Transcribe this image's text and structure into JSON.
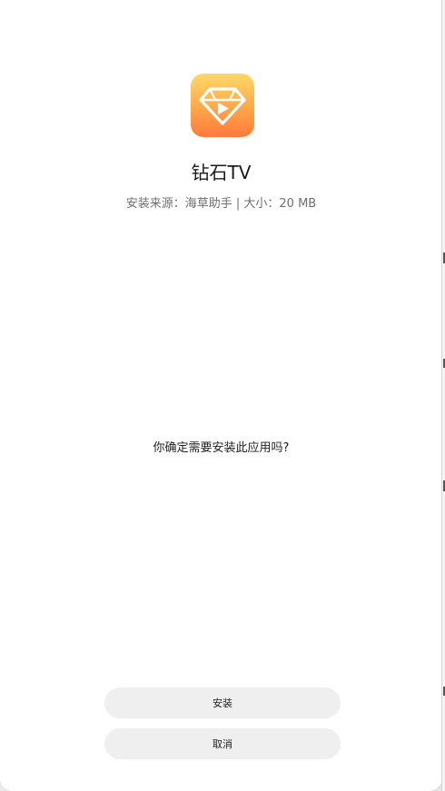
{
  "app": {
    "name": "钻石TV",
    "meta": "安装来源：海草助手 | 大小：20 MB",
    "icon": "diamond-play-icon",
    "icon_colors": [
      "#ffd86a",
      "#ff7a3a"
    ]
  },
  "dialog": {
    "question": "你确定需要安装此应用吗?"
  },
  "buttons": {
    "install_label": "安装",
    "cancel_label": "取消"
  }
}
